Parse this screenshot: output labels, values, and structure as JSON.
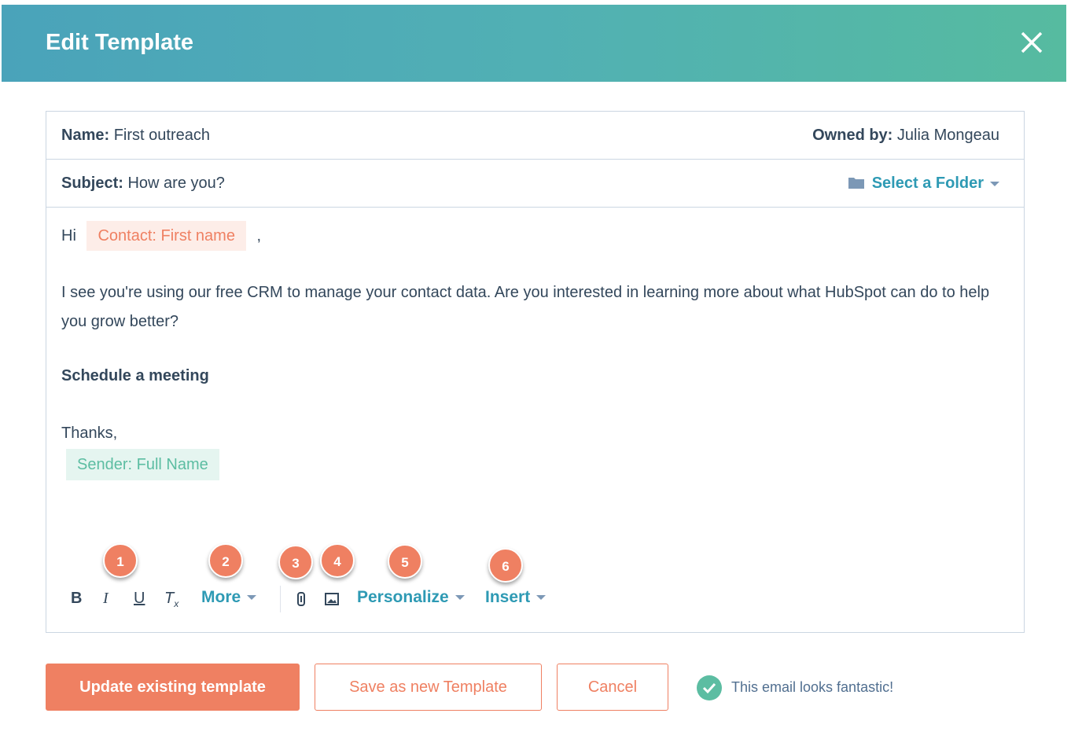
{
  "header": {
    "title": "Edit Template"
  },
  "name": {
    "label": "Name:",
    "value": "First outreach",
    "owner_label": "Owned by:",
    "owner": "Julia Mongeau"
  },
  "subject": {
    "label": "Subject:",
    "value": "How are you?",
    "folder": "Select a Folder"
  },
  "email": {
    "greeting": "Hi",
    "contact_token": "Contact: First name",
    "comma": ",",
    "paragraph": "I see you're using our free CRM to manage your contact data. Are you interested in learning more about what HubSpot can do to help you grow better?",
    "link": "Schedule a meeting",
    "signoff": "Thanks,",
    "sender_token": "Sender: Full Name"
  },
  "toolbar": {
    "bold": "B",
    "italic": "I",
    "underline": "U",
    "clear": "T",
    "more": "More",
    "personalize": "Personalize",
    "insert": "Insert"
  },
  "markers": [
    "1",
    "2",
    "3",
    "4",
    "5",
    "6"
  ],
  "footer": {
    "update": "Update existing template",
    "save_new": "Save as new Template",
    "cancel": "Cancel",
    "status": "This email looks fantastic!"
  },
  "colors": {
    "accent": "#ef8062",
    "link": "#2e9ab4",
    "success": "#5cbda2"
  }
}
